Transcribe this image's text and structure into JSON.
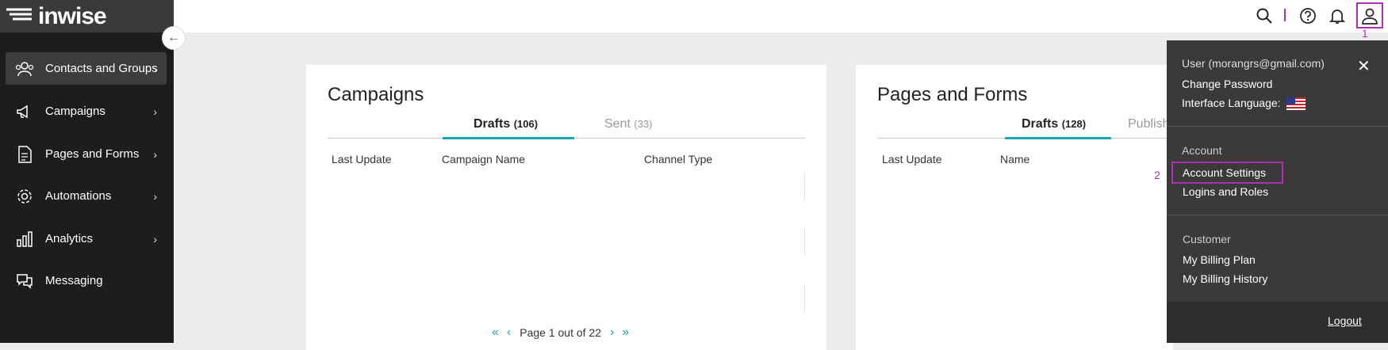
{
  "app": {
    "logo": "inwise"
  },
  "sidebar": {
    "items": [
      {
        "label": "Contacts and Groups",
        "icon": "users-icon",
        "active": true
      },
      {
        "label": "Campaigns",
        "icon": "megaphone-icon"
      },
      {
        "label": "Pages and Forms",
        "icon": "document-icon"
      },
      {
        "label": "Automations",
        "icon": "gear-icon"
      },
      {
        "label": "Analytics",
        "icon": "bar-chart-icon"
      },
      {
        "label": "Messaging",
        "icon": "chat-icon"
      }
    ]
  },
  "annotations": {
    "one": "1",
    "two": "2"
  },
  "campaigns": {
    "title": "Campaigns",
    "tab_drafts": "Drafts",
    "tab_drafts_count": "(106)",
    "tab_sent": "Sent",
    "tab_sent_count": "(33)",
    "columns": [
      "Last Update",
      "Campaign Name",
      "Channel Type"
    ],
    "pager": "Page 1 out of 22"
  },
  "pages": {
    "title": "Pages and Forms",
    "tab_drafts": "Drafts",
    "tab_drafts_count": "(128)",
    "tab_published": "Publish",
    "columns": [
      "Last Update",
      "Name"
    ]
  },
  "user_menu": {
    "user": "User (morangrs@gmail.com)",
    "change_password": "Change Password",
    "interface_language": "Interface Language:",
    "account_heading": "Account",
    "account_settings": "Account Settings",
    "logins_roles": "Logins and Roles",
    "customer_heading": "Customer",
    "billing_plan": "My Billing Plan",
    "billing_history": "My Billing History",
    "logout": "Logout"
  },
  "colors": {
    "accent": "#19a8b3",
    "highlight": "#b030b0",
    "sidebar": "#1d1d1d"
  }
}
